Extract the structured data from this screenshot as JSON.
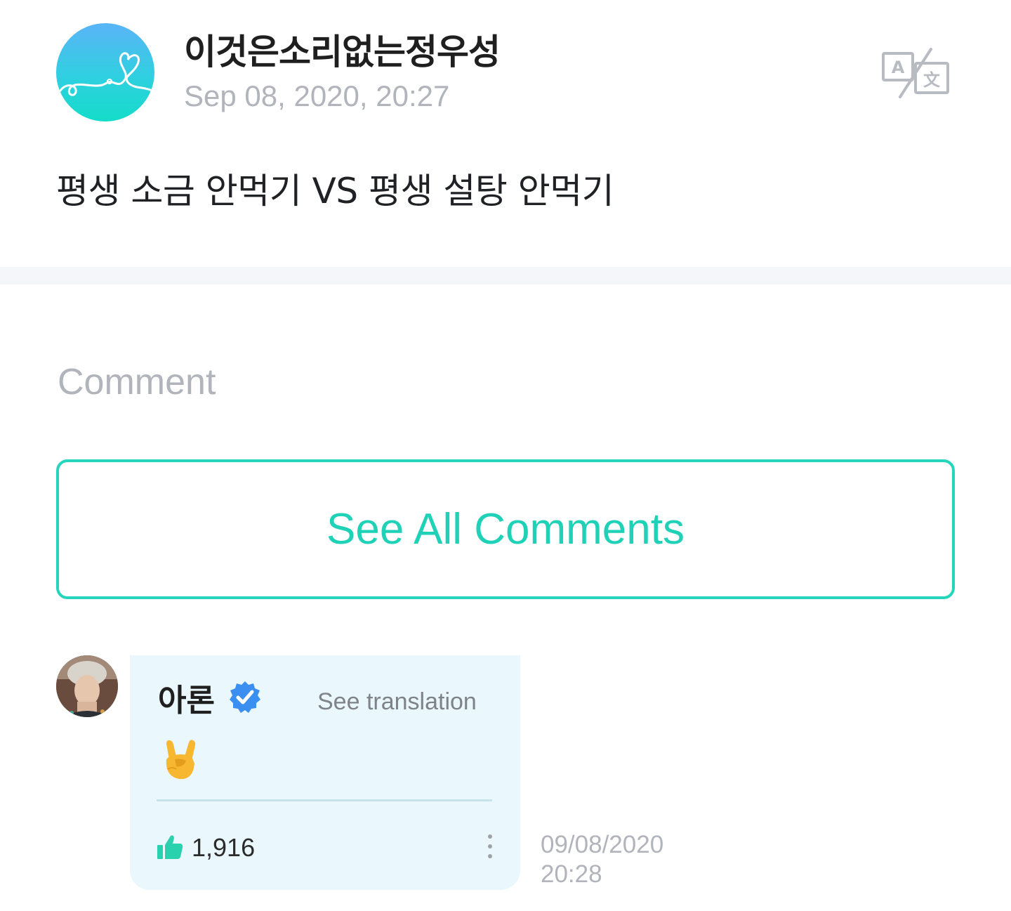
{
  "post": {
    "author": "이것은소리없는정우성",
    "date": "Sep 08, 2020, 20:27",
    "body": "평생 소금 안먹기 VS 평생 설탕 안먹기",
    "translate_icon": "translate-icon"
  },
  "comments_section": {
    "heading": "Comment",
    "see_all_label": "See All Comments"
  },
  "comment": {
    "author": "아론",
    "verified_icon": "verified-badge-icon",
    "see_translation": "See translation",
    "text_emoji": "sign-of-the-horns-emoji",
    "likes": "1,916",
    "timestamp_date": "09/08/2020",
    "timestamp_time": "20:28"
  },
  "colors": {
    "accent": "#1fd2b7",
    "muted": "#b1b4bb",
    "bubble": "#eaf7fd",
    "verified": "#3b8ff0"
  }
}
